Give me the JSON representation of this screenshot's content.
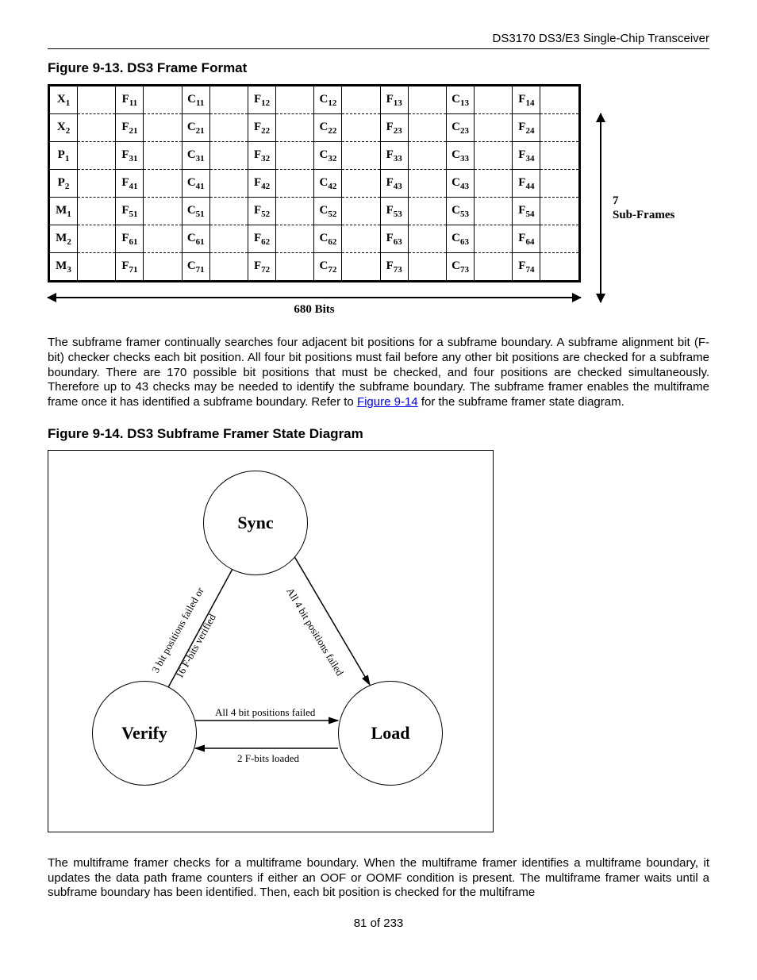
{
  "header": {
    "doc_title": "DS3170 DS3/E3 Single-Chip Transceiver"
  },
  "fig913": {
    "title": "Figure 9-13. DS3 Frame Format",
    "row_heads": [
      "X1",
      "X2",
      "P1",
      "P2",
      "M1",
      "M2",
      "M3"
    ],
    "patterns": [
      "F",
      "C",
      "F",
      "C",
      "F",
      "C",
      "F"
    ],
    "v_label": "7 Sub-Frames",
    "h_label": "680 Bits"
  },
  "para1": {
    "text_a": "The subframe framer continually searches four adjacent bit positions for a subframe boundary. A subframe alignment bit (F-bit) checker checks each bit position. All four bit positions must fail before any other bit positions are checked for a subframe boundary. There are 170 possible bit positions that must be checked, and four positions are checked simultaneously. Therefore up to 43 checks may be needed to identify the subframe boundary. The subframe framer enables the multiframe frame once it has identified a subframe boundary.  Refer to ",
    "link": "Figure 9-14",
    "text_b": " for the subframe framer state diagram."
  },
  "fig914": {
    "title": "Figure 9-14. DS3 Subframe Framer State Diagram",
    "states": {
      "sync": "Sync",
      "verify": "Verify",
      "load": "Load"
    },
    "edges": {
      "sync_to_load": "All 4 bit positions failed",
      "verify_to_sync_a": "3 bit positions failed or",
      "verify_to_sync_b": "16 F-bits verified",
      "verify_to_load": "All 4 bit positions failed",
      "load_to_verify": "2 F-bits loaded"
    }
  },
  "para2": {
    "text": "The multiframe framer checks for a multiframe boundary. When the multiframe framer identifies a multiframe boundary, it updates the data path frame counters if either an OOF or OOMF condition is present. The multiframe framer waits until a subframe boundary has been identified. Then, each bit position is checked for the multiframe"
  },
  "footer": {
    "text": "81 of 233"
  }
}
